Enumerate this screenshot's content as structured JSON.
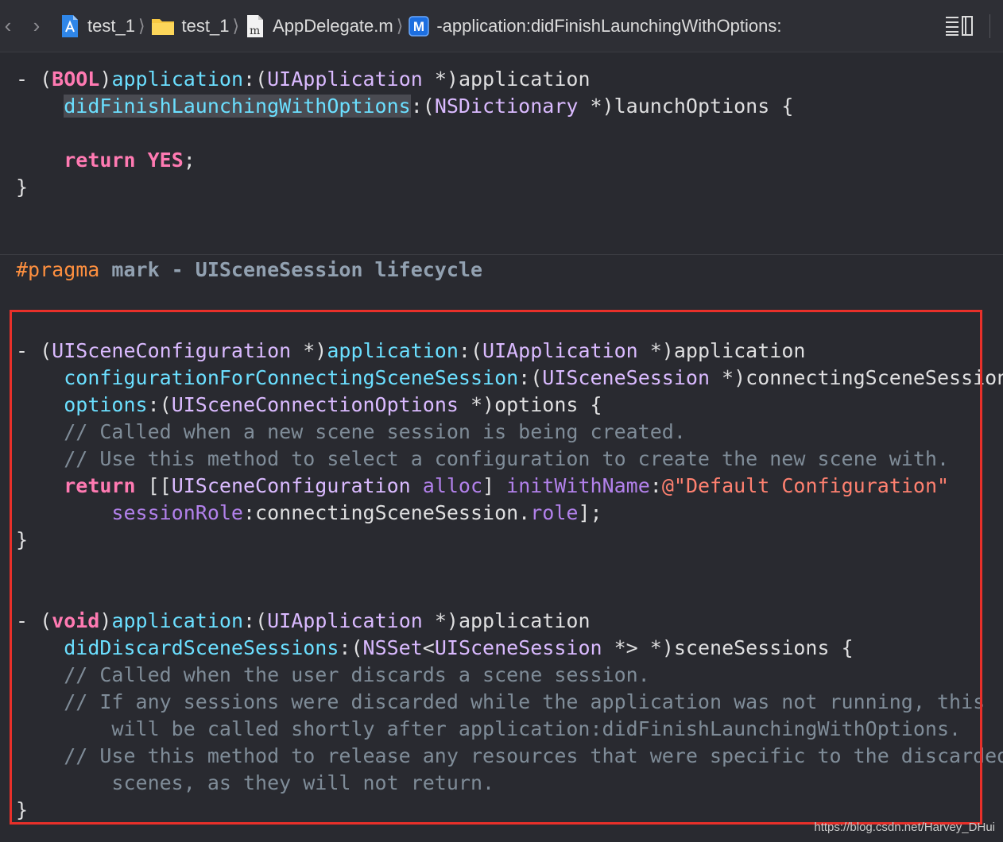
{
  "jumpbar": {
    "crumbs": [
      {
        "label": "test_1",
        "icon": "xcode-project-icon"
      },
      {
        "label": "test_1",
        "icon": "folder-icon"
      },
      {
        "label": "AppDelegate.m",
        "icon": "objc-file-icon"
      },
      {
        "label": "-application:didFinishLaunchingWithOptions:",
        "icon": "method-icon",
        "badge": "M"
      }
    ],
    "colors": {
      "folder": "#f7c842",
      "method_badge": "#1d6fe0"
    }
  },
  "code": {
    "l1": {
      "dash": "- (",
      "t1": "BOOL",
      "p1": ")",
      "m1": "application",
      "p2": ":(",
      "t2": "UIApplication",
      "p3": " *)application"
    },
    "l2": {
      "indent": "    ",
      "m1": "didFinishLaunchingWithOptions",
      "p1": ":(",
      "t1": "NSDictionary",
      "p2": " *)launchOptions {"
    },
    "l3": {
      "indent": "    ",
      "k1": "return",
      "sp": " ",
      "k2": "YES",
      "p1": ";"
    },
    "l4": {
      "brace": "}"
    },
    "l5": {
      "pp": "#pragma",
      "sp": " ",
      "mark": "mark - UISceneSession lifecycle"
    },
    "l6": {
      "dash": "- (",
      "t1": "UISceneConfiguration",
      "p1": " *)",
      "m1": "application",
      "p2": ":(",
      "t2": "UIApplication",
      "p3": " *)application"
    },
    "l7": {
      "indent": "    ",
      "m1": "configurationForConnectingSceneSession",
      "p1": ":(",
      "t1": "UISceneSession",
      "p2": " *)connectingSceneSession"
    },
    "l8": {
      "indent": "    ",
      "m1": "options",
      "p1": ":(",
      "t1": "UISceneConnectionOptions",
      "p2": " *)options {"
    },
    "l9": {
      "indent": "    ",
      "c": "// Called when a new scene session is being created."
    },
    "l10": {
      "indent": "    ",
      "c": "// Use this method to select a configuration to create the new scene with."
    },
    "l11": {
      "indent": "    ",
      "k1": "return",
      "p1": " [[",
      "t1": "UISceneConfiguration",
      "sp": " ",
      "p2": "alloc",
      "p3": "] ",
      "p4": "initWithName",
      "p5": ":",
      "s": "@\"Default Configuration\""
    },
    "l12": {
      "indent": "        ",
      "p1": "sessionRole",
      "p2": ":connectingSceneSession.",
      "p3": "role",
      "p4": "];"
    },
    "l13": {
      "brace": "}"
    },
    "l14": {
      "dash": "- (",
      "k1": "void",
      "p1": ")",
      "m1": "application",
      "p2": ":(",
      "t1": "UIApplication",
      "p3": " *)application"
    },
    "l15": {
      "indent": "    ",
      "m1": "didDiscardSceneSessions",
      "p1": ":(",
      "t1": "NSSet",
      "p2": "<",
      "t2": "UISceneSession",
      "p3": " *> *)sceneSessions {"
    },
    "l16": {
      "indent": "    ",
      "c": "// Called when the user discards a scene session."
    },
    "l17": {
      "indent": "    ",
      "c": "// If any sessions were discarded while the application was not running, this"
    },
    "l18": {
      "indent": "        ",
      "c": "will be called shortly after application:didFinishLaunchingWithOptions."
    },
    "l19": {
      "indent": "    ",
      "c": "// Use this method to release any resources that were specific to the discarded"
    },
    "l20": {
      "indent": "        ",
      "c": "scenes, as they will not return."
    },
    "l21": {
      "brace": "}"
    }
  },
  "watermark": "https://blog.csdn.net/Harvey_DHui"
}
